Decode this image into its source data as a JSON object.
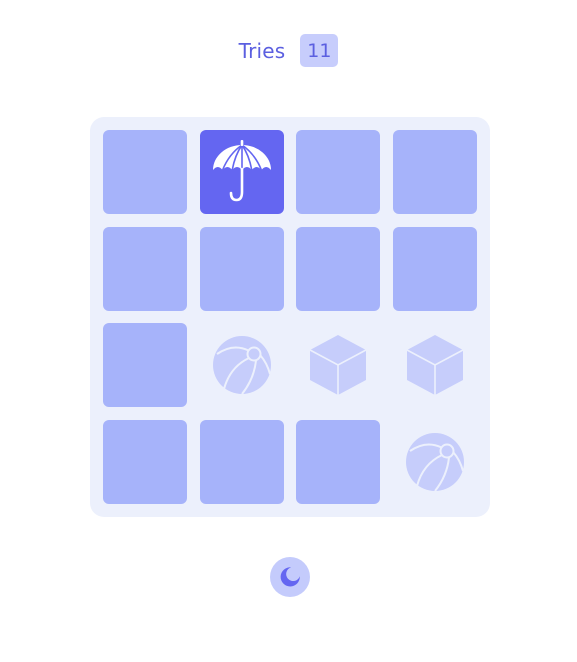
{
  "header": {
    "tries_label": "Tries",
    "tries_count": "11"
  },
  "board": {
    "rows": 4,
    "columns": 4,
    "tiles": [
      {
        "state": "hidden",
        "icon": null
      },
      {
        "state": "flipped",
        "icon": "umbrella-icon"
      },
      {
        "state": "hidden",
        "icon": null
      },
      {
        "state": "hidden",
        "icon": null
      },
      {
        "state": "hidden",
        "icon": null
      },
      {
        "state": "hidden",
        "icon": null
      },
      {
        "state": "hidden",
        "icon": null
      },
      {
        "state": "hidden",
        "icon": null
      },
      {
        "state": "hidden",
        "icon": null
      },
      {
        "state": "matched",
        "icon": "beach-ball-icon"
      },
      {
        "state": "matched",
        "icon": "cube-icon"
      },
      {
        "state": "matched",
        "icon": "cube-icon"
      },
      {
        "state": "hidden",
        "icon": null
      },
      {
        "state": "hidden",
        "icon": null
      },
      {
        "state": "hidden",
        "icon": null
      },
      {
        "state": "matched",
        "icon": "beach-ball-icon"
      }
    ]
  },
  "footer": {
    "theme_toggle_icon": "moon-icon"
  },
  "colors": {
    "accent": "#6466f1",
    "tile_hidden": "#a6b3fa",
    "board_background": "#ecf0fc",
    "matched_icon": "#c6cdfb"
  }
}
